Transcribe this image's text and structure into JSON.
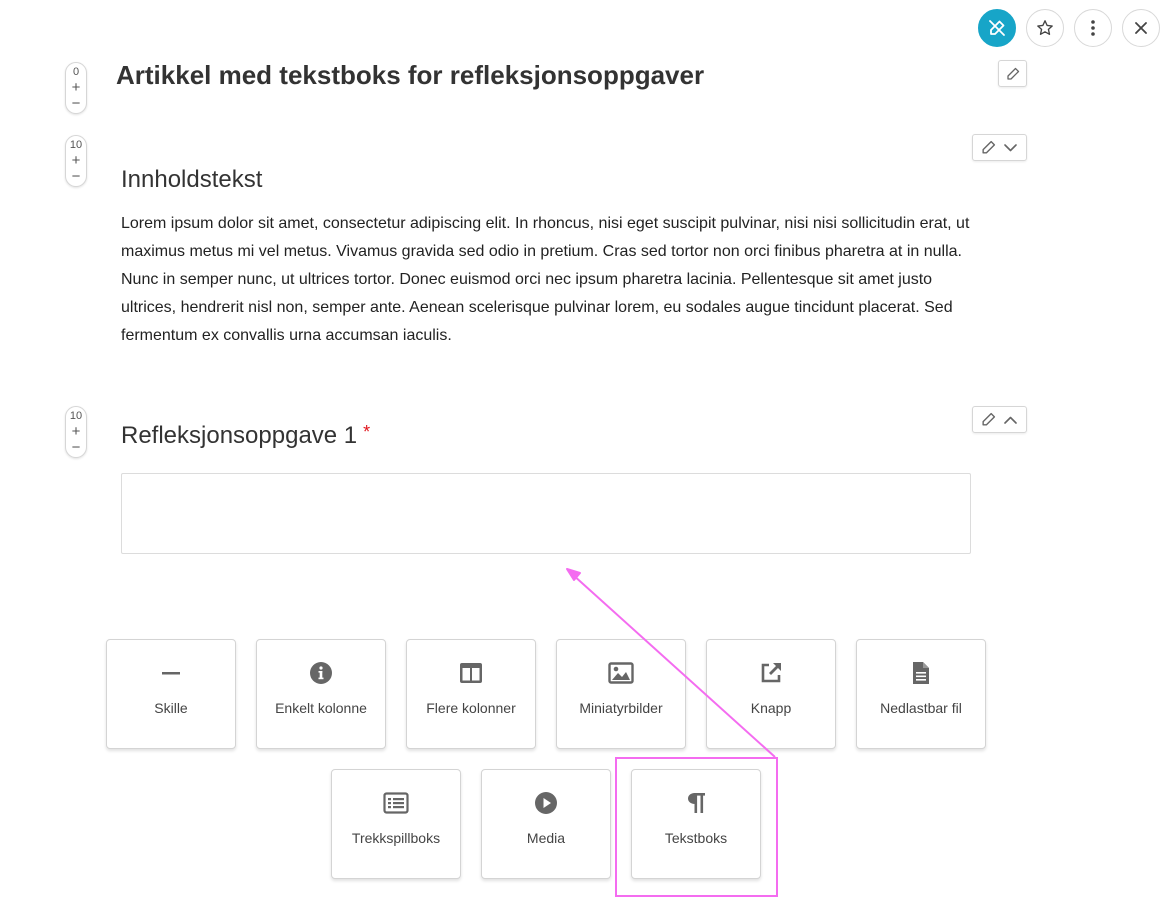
{
  "toolbar": {
    "edit_mode_icon": "pen-slash-icon",
    "favorite_icon": "star-icon",
    "more_icon": "kebab-icon",
    "close_icon": "close-icon",
    "active_color": "#17a5c8"
  },
  "article": {
    "title": "Artikkel med tekstboks for refleksjonsoppgaver",
    "title_counter": "0",
    "sections": [
      {
        "counter": "10",
        "heading": "Innholdstekst",
        "body": "Lorem ipsum dolor sit amet, consectetur adipiscing elit. In rhoncus, nisi eget suscipit pulvinar, nisi nisi sollicitudin erat, ut maximus metus mi vel metus. Vivamus gravida sed odio in pretium. Cras sed tortor non orci finibus pharetra at in nulla. Nunc in semper nunc, ut ultrices tortor. Donec euismod orci nec ipsum pharetra lacinia. Pellentesque sit amet justo ultrices, hendrerit nisl non, semper ante. Aenean scelerisque pulvinar lorem, eu sodales augue tincidunt placerat. Sed fermentum ex convallis urna accumsan iaculis."
      },
      {
        "counter": "10",
        "heading": "Refleksjonsoppgave 1",
        "required_marker": "*",
        "answer_value": ""
      }
    ]
  },
  "blocks": [
    {
      "label": "Skille",
      "icon": "divider-icon"
    },
    {
      "label": "Enkelt kolonne",
      "icon": "info-circle-icon"
    },
    {
      "label": "Flere kolonner",
      "icon": "columns-icon"
    },
    {
      "label": "Miniatyrbilder",
      "icon": "image-icon"
    },
    {
      "label": "Knapp",
      "icon": "external-link-icon"
    },
    {
      "label": "Nedlastbar fil",
      "icon": "file-icon"
    },
    {
      "label": "Trekkspillboks",
      "icon": "list-icon"
    },
    {
      "label": "Media",
      "icon": "play-icon"
    },
    {
      "label": "Tekstboks",
      "icon": "paragraph-icon"
    }
  ],
  "annotation": {
    "highlight_color": "#f46cf0"
  }
}
